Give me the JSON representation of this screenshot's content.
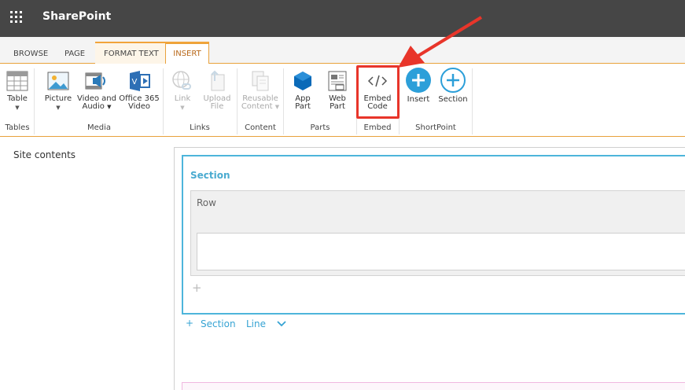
{
  "suite_bar": {
    "app_name": "SharePoint",
    "waffle_icon": "waffle-icon"
  },
  "tabs": [
    {
      "label": "BROWSE",
      "selected": false
    },
    {
      "label": "PAGE",
      "selected": false
    },
    {
      "label": "FORMAT TEXT",
      "selected": false
    },
    {
      "label": "INSERT",
      "selected": true
    }
  ],
  "ribbon": {
    "groups": [
      {
        "label": "Tables",
        "buttons": [
          {
            "label": "Table",
            "icon": "table-icon",
            "has_dropdown": true,
            "enabled": true
          }
        ]
      },
      {
        "label": "Media",
        "buttons": [
          {
            "label": "Picture",
            "icon": "picture-icon",
            "has_dropdown": true,
            "enabled": true
          },
          {
            "label": "Video and Audio",
            "icon": "video-audio-icon",
            "has_dropdown": true,
            "enabled": true
          },
          {
            "label": "Office 365 Video",
            "icon": "office365-video-icon",
            "has_dropdown": false,
            "enabled": true
          }
        ]
      },
      {
        "label": "Links",
        "buttons": [
          {
            "label": "Link",
            "icon": "link-icon",
            "has_dropdown": true,
            "enabled": false
          },
          {
            "label": "Upload File",
            "icon": "upload-file-icon",
            "has_dropdown": false,
            "enabled": false
          }
        ]
      },
      {
        "label": "Content",
        "buttons": [
          {
            "label": "Reusable Content",
            "icon": "reusable-content-icon",
            "has_dropdown": true,
            "enabled": false
          }
        ]
      },
      {
        "label": "Parts",
        "buttons": [
          {
            "label": "App Part",
            "icon": "app-part-icon",
            "has_dropdown": false,
            "enabled": true
          },
          {
            "label": "Web Part",
            "icon": "web-part-icon",
            "has_dropdown": false,
            "enabled": true
          }
        ]
      },
      {
        "label": "Embed",
        "buttons": [
          {
            "label": "Embed Code",
            "icon": "embed-code-icon",
            "has_dropdown": false,
            "enabled": true,
            "highlighted": true
          }
        ]
      },
      {
        "label": "ShortPoint",
        "buttons": [
          {
            "label": "Insert",
            "icon": "plus-circle-filled-icon",
            "has_dropdown": false,
            "enabled": true
          },
          {
            "label": "Section",
            "icon": "plus-circle-outline-icon",
            "has_dropdown": false,
            "enabled": true
          }
        ]
      }
    ]
  },
  "labels": {
    "table": "Table",
    "picture": "Picture",
    "video1": "Video and",
    "video2": "Audio",
    "o365_1": "Office 365",
    "o365_2": "Video",
    "link": "Link",
    "upload1": "Upload",
    "upload2": "File",
    "reusable1": "Reusable",
    "reusable2": "Content",
    "app1": "App",
    "app2": "Part",
    "web1": "Web",
    "web2": "Part",
    "embed1": "Embed",
    "embed2": "Code",
    "insert": "Insert",
    "section": "Section"
  },
  "left_nav": {
    "site_contents": "Site contents"
  },
  "editor": {
    "section_title": "Section",
    "row_title": "Row",
    "add_plus": "+",
    "bottom_actions": {
      "plus": "+",
      "section": "Section",
      "line": "Line",
      "chevron": "chevron-down-icon"
    }
  },
  "colors": {
    "suite_bar": "#464646",
    "accent_orange": "#e8a23c",
    "highlight_red": "#e8352a",
    "shortpoint_blue": "#2c9fd9",
    "section_border": "#4db5db"
  }
}
